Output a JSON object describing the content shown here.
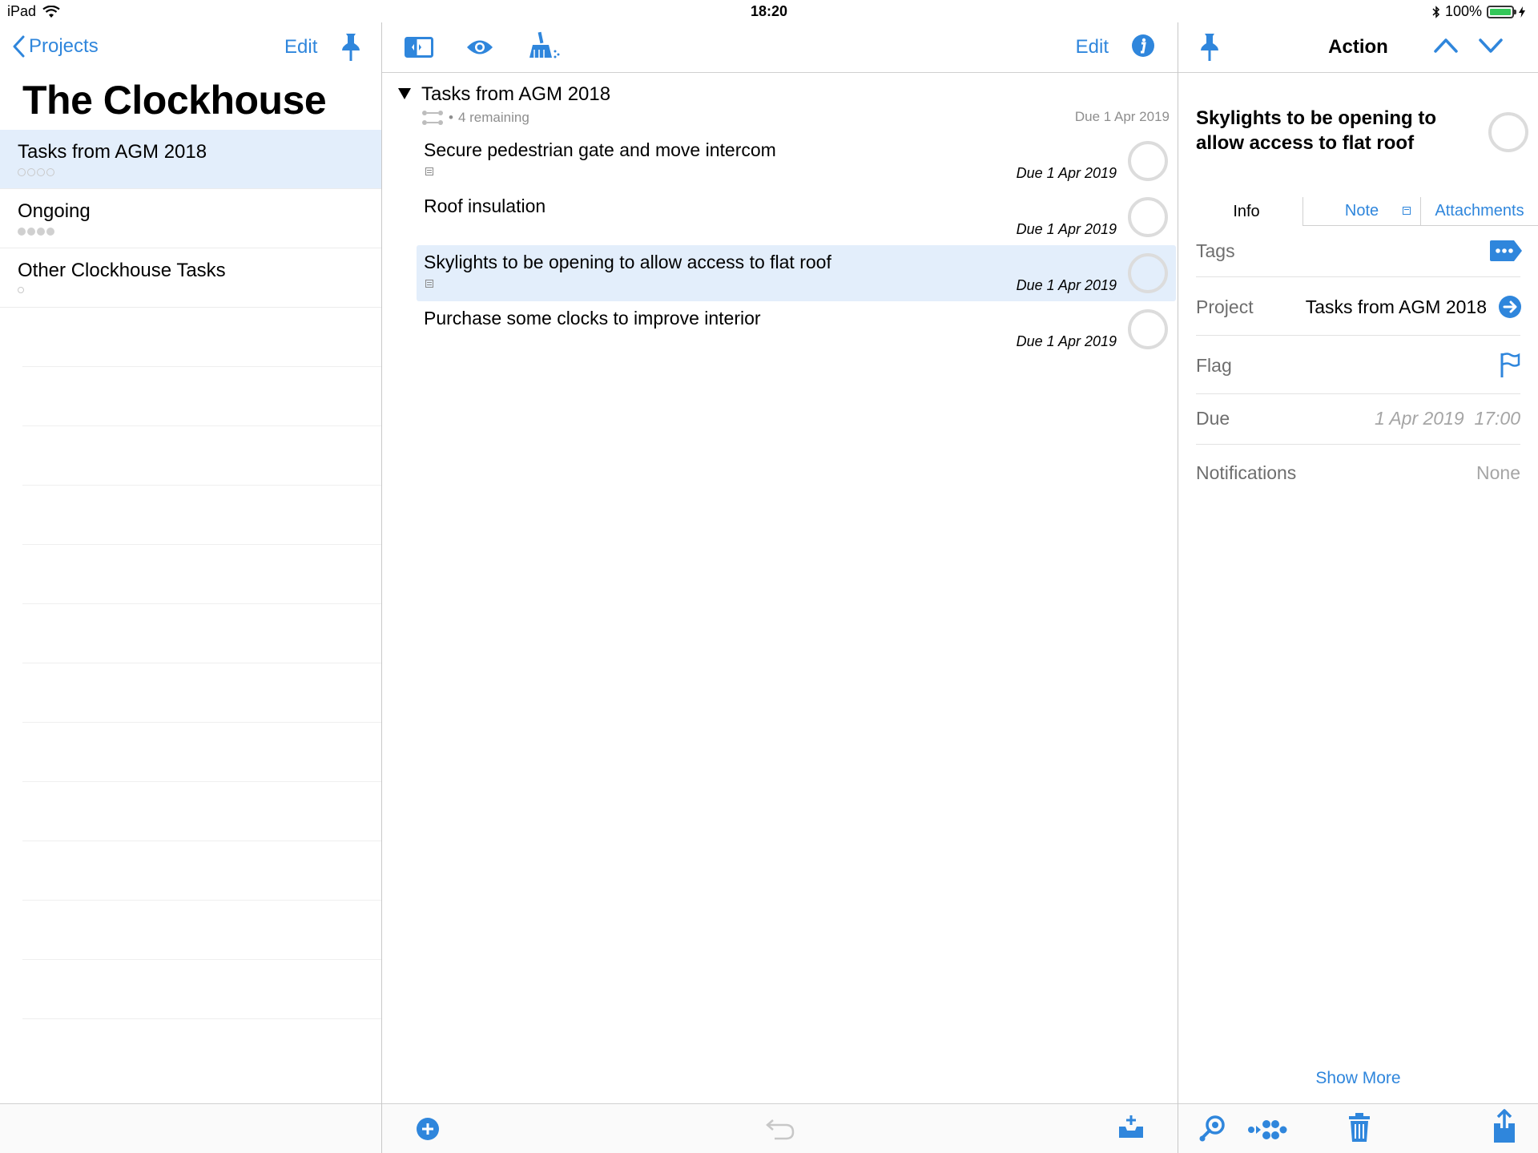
{
  "status_bar": {
    "device": "iPad",
    "time": "18:20",
    "battery": "100%",
    "battery_level": 1.0
  },
  "left_pane": {
    "back_label": "Projects",
    "edit_label": "Edit",
    "title": "The Clockhouse",
    "projects": [
      {
        "name": "Tasks from AGM 2018",
        "selected": true,
        "dots": "hollow-4"
      },
      {
        "name": "Ongoing",
        "selected": false,
        "dots": "filled-4"
      },
      {
        "name": "Other Clockhouse Tasks",
        "selected": false,
        "dots": "hollow-1"
      }
    ]
  },
  "middle_pane": {
    "edit_label": "Edit",
    "group": {
      "title": "Tasks from AGM 2018",
      "remaining": "4 remaining",
      "due": "Due 1 Apr 2019"
    },
    "tasks": [
      {
        "title": "Secure pedestrian gate and move intercom",
        "due": "Due 1 Apr 2019",
        "has_note": true,
        "selected": false
      },
      {
        "title": "Roof insulation",
        "due": "Due 1 Apr 2019",
        "has_note": false,
        "selected": false
      },
      {
        "title": "Skylights to be opening to allow access to flat roof",
        "due": "Due 1 Apr 2019",
        "has_note": true,
        "selected": true
      },
      {
        "title": "Purchase some clocks to improve interior",
        "due": "Due 1 Apr 2019",
        "has_note": false,
        "selected": false
      }
    ]
  },
  "right_pane": {
    "title": "Action",
    "action_title": "Skylights to be opening to allow access to flat roof",
    "tabs": {
      "info": "Info",
      "note": "Note",
      "attachments": "Attachments"
    },
    "fields": {
      "tags_label": "Tags",
      "project_label": "Project",
      "project_value": "Tasks from AGM 2018",
      "flag_label": "Flag",
      "due_label": "Due",
      "due_value": "1 Apr 2019  17:00",
      "notifications_label": "Notifications",
      "notifications_value": "None"
    },
    "show_more": "Show More"
  },
  "colors": {
    "accent": "#2f86dc",
    "selection": "#e3eefb",
    "secondary_text": "#8e8e8e"
  }
}
